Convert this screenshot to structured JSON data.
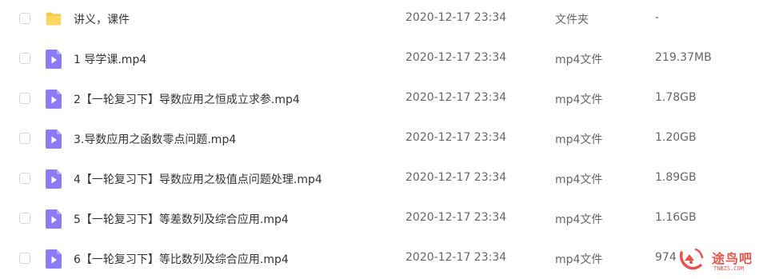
{
  "files": [
    {
      "name": "讲义，课件",
      "date": "2020-12-17 23:34",
      "type": "文件夹",
      "size": "-",
      "icon": "folder-icon"
    },
    {
      "name": "1 导学课.mp4",
      "date": "2020-12-17 23:34",
      "type": "mp4文件",
      "size": "219.37MB",
      "icon": "video-file-icon"
    },
    {
      "name": "2【一轮复习下】导数应用之恒成立求参.mp4",
      "date": "2020-12-17 23:34",
      "type": "mp4文件",
      "size": "1.78GB",
      "icon": "video-file-icon"
    },
    {
      "name": "3.导数应用之函数零点问题.mp4",
      "date": "2020-12-17 23:34",
      "type": "mp4文件",
      "size": "1.20GB",
      "icon": "video-file-icon"
    },
    {
      "name": "4【一轮复习下】导数应用之极值点问题处理.mp4",
      "date": "2020-12-17 23:34",
      "type": "mp4文件",
      "size": "1.89GB",
      "icon": "video-file-icon"
    },
    {
      "name": "5【一轮复习下】等差数列及综合应用.mp4",
      "date": "2020-12-17 23:34",
      "type": "mp4文件",
      "size": "1.16GB",
      "icon": "video-file-icon"
    },
    {
      "name": "6【一轮复习下】等比数列及综合应用.mp4",
      "date": "2020-12-17 23:34",
      "type": "mp4文件",
      "size": "974.",
      "icon": "video-file-icon"
    }
  ],
  "watermark": {
    "text": "途鸟吧",
    "subtext": "TNBZS.COM"
  },
  "colors": {
    "folder": "#f7c948",
    "video": "#8b7cf6",
    "watermark": "#e8534b"
  }
}
